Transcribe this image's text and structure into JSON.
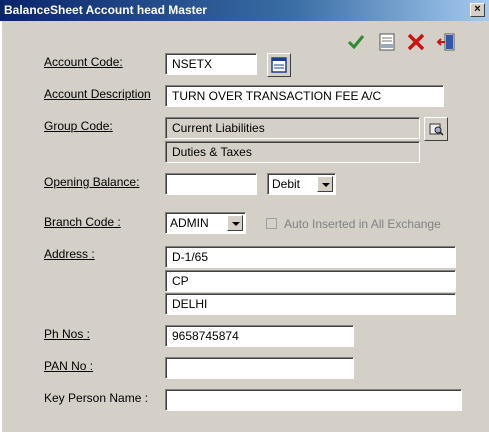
{
  "window": {
    "title": "BalanceSheet Account head Master",
    "close_label": "×"
  },
  "toolbar": {
    "save": "check-icon",
    "clear": "clear-icon",
    "delete": "x-icon",
    "exit": "exit-icon",
    "save_color": "#2e8b2e",
    "delete_color": "#cc1111"
  },
  "form": {
    "account_code": {
      "label": "Account Code:",
      "value": "NSETX"
    },
    "account_description": {
      "label": "Account Description",
      "value": "TURN OVER TRANSACTION FEE A/C"
    },
    "group_code": {
      "label": "Group Code:",
      "value": "Current Liabilities",
      "sub_value": "Duties & Taxes"
    },
    "opening_balance": {
      "label": "Opening Balance:",
      "value": "",
      "type_selected": "Debit"
    },
    "branch_code": {
      "label": "Branch Code :",
      "selected": "ADMIN"
    },
    "auto_inserted": {
      "label": "Auto Inserted in All Exchange",
      "checked": false
    },
    "address": {
      "label": "Address :",
      "line1": "D-1/65",
      "line2": "CP",
      "line3": "DELHI"
    },
    "ph_nos": {
      "label": "Ph Nos :",
      "value": "9658745874"
    },
    "pan_no": {
      "label": "PAN No :",
      "value": ""
    },
    "key_person": {
      "label": "Key Person Name :",
      "value": ""
    }
  }
}
